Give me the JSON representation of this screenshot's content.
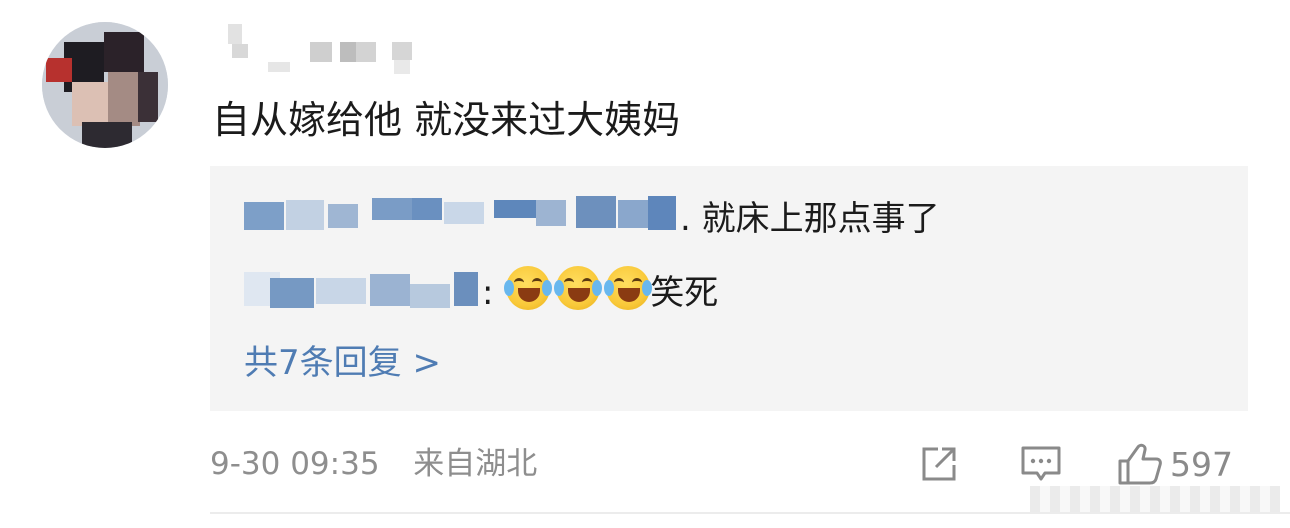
{
  "comment": {
    "text": "自从嫁给他 就没来过大姨妈",
    "replies": [
      {
        "body": ". 就床上那点事了"
      },
      {
        "colon": ":",
        "emojis": [
          "laugh-cry",
          "laugh-cry",
          "laugh-cry"
        ],
        "body": "笑死"
      }
    ],
    "more_replies": "共7条回复 >",
    "timestamp": "9-30 09:35",
    "location": "来自湖北",
    "like_count": "597"
  },
  "colors": {
    "link_blue": "#4f7cb3",
    "text_dark": "#1b1b1b",
    "text_gray": "#8e8e8e",
    "reply_bg": "#f4f4f4"
  },
  "icons": {
    "share": "share-icon",
    "reply": "comment-icon",
    "like": "thumbs-up-icon"
  }
}
